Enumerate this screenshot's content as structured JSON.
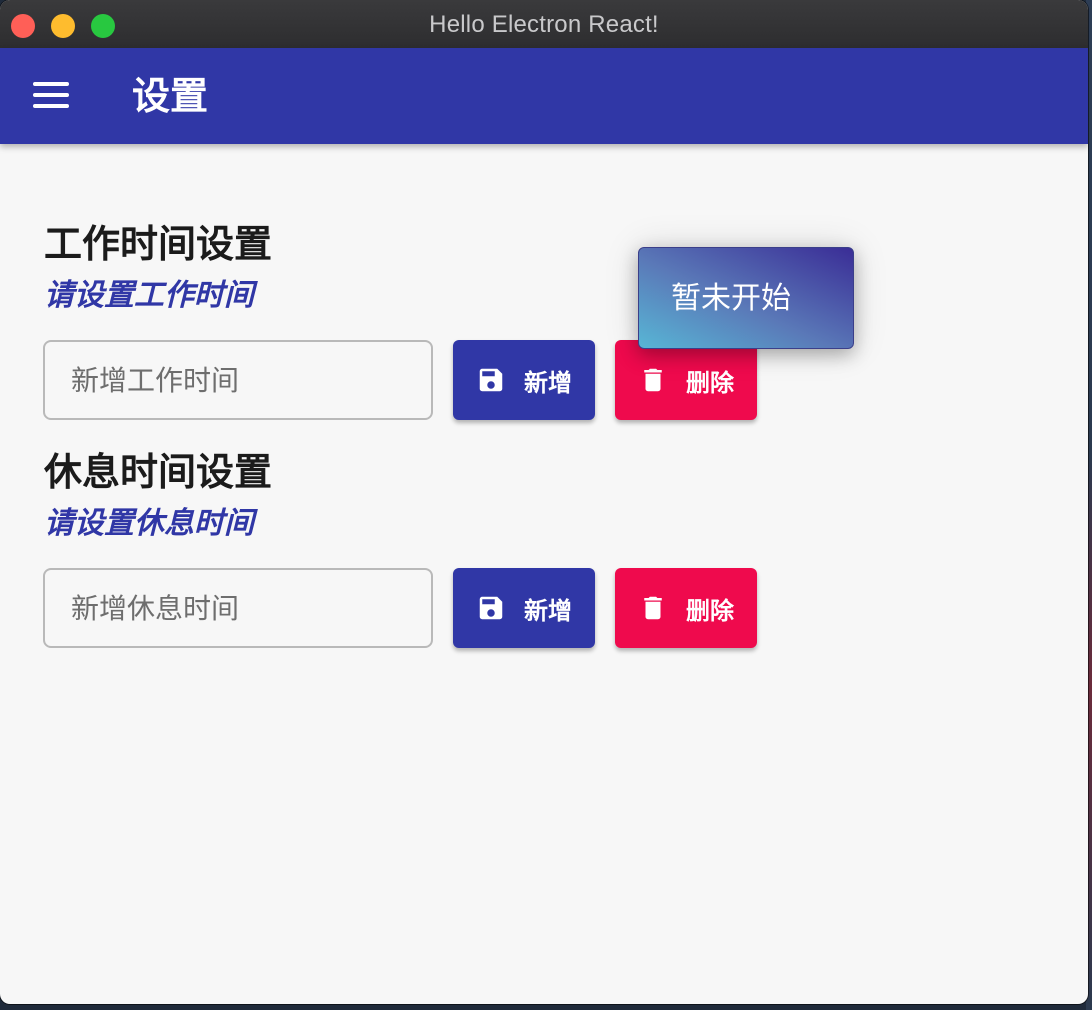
{
  "window": {
    "title": "Hello Electron React!",
    "traffic_lights": [
      "close",
      "minimize",
      "maximize"
    ]
  },
  "appbar": {
    "menu_icon": "menu-icon",
    "title": "设置",
    "color": "#3037a6"
  },
  "work_section": {
    "title": "工作时间设置",
    "subtitle": "请设置工作时间",
    "input_placeholder": "新增工作时间",
    "add_label": "新增",
    "delete_label": "删除"
  },
  "rest_section": {
    "title": "休息时间设置",
    "subtitle": "请设置休息时间",
    "input_placeholder": "新增休息时间",
    "add_label": "新增",
    "delete_label": "删除"
  },
  "status": {
    "text": "暂未开始"
  },
  "icons": {
    "add": "save-icon",
    "delete": "trash-icon"
  },
  "colors": {
    "primary": "#3037a6",
    "danger": "#ef0a4d",
    "background": "#f7f7f7"
  }
}
